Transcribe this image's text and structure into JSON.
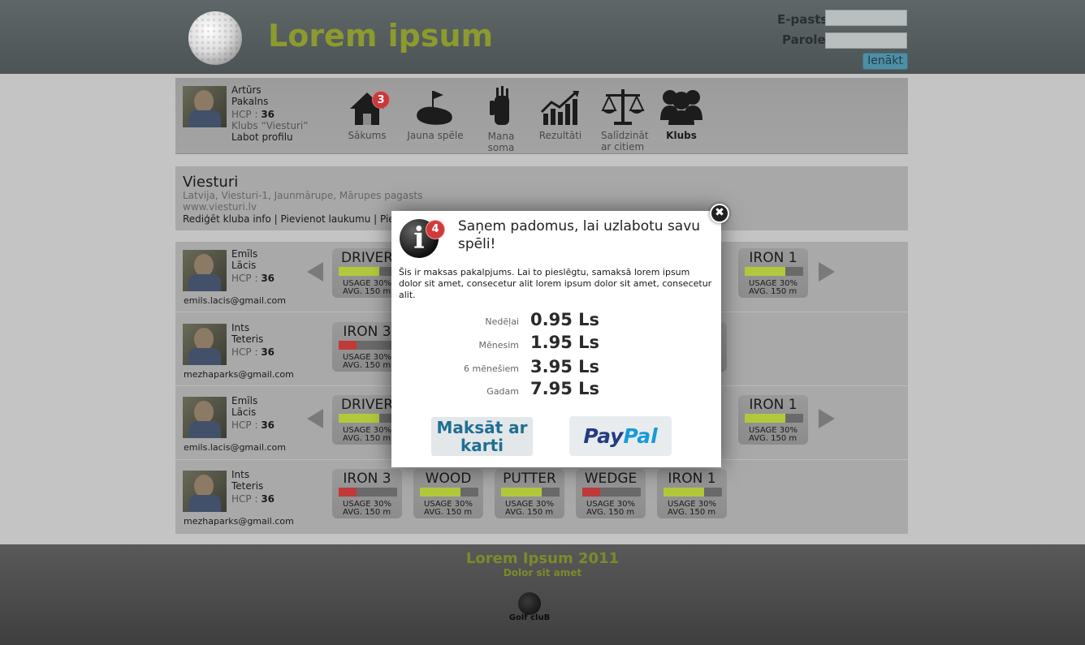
{
  "header": {
    "site_title": "Lorem ipsum",
    "email_label": "E-pasts",
    "password_label": "Parole",
    "login_button": "Ienākt"
  },
  "profile": {
    "first_name": "Artūrs",
    "last_name": "Pakalns",
    "hcp_label": "HCP :",
    "hcp_value": "36",
    "club": "Klubs “Viesturi”",
    "edit_link": "Labot profilu"
  },
  "nav": [
    {
      "label": "Sākums",
      "badge": "3",
      "icon": "home-icon"
    },
    {
      "label": "Jauna spēle",
      "icon": "golf-green-icon"
    },
    {
      "label": "Mana soma",
      "icon": "golf-bag-icon"
    },
    {
      "label": "Rezultāti",
      "icon": "chart-icon"
    },
    {
      "label": "Salīdzināt",
      "label2": "ar citiem",
      "icon": "scales-icon"
    },
    {
      "label": "Klubs",
      "icon": "group-icon"
    }
  ],
  "club": {
    "name": "Viesturi",
    "address": "Latvija, Viesturi-1, Jaunmārupe, Mārupes pagasts",
    "website": "www.viesturi.lv",
    "link_edit": "Rediģēt kluba info",
    "separator": "|",
    "link_add_course": "Pievienot laukumu",
    "link_more": "Piet"
  },
  "players": [
    {
      "first": "Emīls",
      "last": "Lācis",
      "hcp_label": "HCP :",
      "hcp": "36",
      "email": "emils.lacis@gmail.com",
      "cards": [
        {
          "title": "DRIVER",
          "usage": "USAGE 30%",
          "avg": "AVG. 150 m"
        },
        {
          "title": "IRON 1",
          "usage": "USAGE 30%",
          "avg": "AVG. 150 m"
        }
      ]
    },
    {
      "first": "Ints",
      "last": "Teteris",
      "hcp_label": "HCP :",
      "hcp": "36",
      "email": "mezhaparks@gmail.com",
      "cards": [
        {
          "title": "IRON 3",
          "usage": "USAGE 30%",
          "avg": "AVG. 150 m"
        }
      ]
    },
    {
      "first": "Emīls",
      "last": "Lācis",
      "hcp_label": "HCP :",
      "hcp": "36",
      "email": "emils.lacis@gmail.com",
      "cards": [
        {
          "title": "DRIVER",
          "usage": "USAGE 30%",
          "avg": "AVG. 150 m"
        },
        {
          "title": "IRON 1",
          "usage": "USAGE 30%",
          "avg": "AVG. 150 m"
        }
      ]
    },
    {
      "first": "Ints",
      "last": "Teteris",
      "hcp_label": "HCP :",
      "hcp": "36",
      "email": "mezhaparks@gmail.com",
      "cards": [
        {
          "title": "IRON 3",
          "usage": "USAGE 30%",
          "avg": "AVG. 150 m"
        },
        {
          "title": "WOOD",
          "usage": "USAGE 30%",
          "avg": "AVG. 150 m"
        },
        {
          "title": "PUTTER",
          "usage": "USAGE 30%",
          "avg": "AVG. 150 m"
        },
        {
          "title": "WEDGE",
          "usage": "USAGE 30%",
          "avg": "AVG. 150 m"
        },
        {
          "title": "IRON 1",
          "usage": "USAGE 30%",
          "avg": "AVG. 150 m"
        }
      ]
    }
  ],
  "modal": {
    "badge": "4",
    "info_glyph": "i",
    "close_glyph": "✖",
    "title": "Saņem padomus, lai uzlabotu savu spēli!",
    "description": "Šis ir maksas pakalpjums. Lai to pieslēgtu, samaksā lorem ipsum dolor sit amet, consecetur alit lorem ipsum dolor sit amet, consecetur alit.",
    "prices": [
      {
        "label": "Nedēļai",
        "value": "0.95 Ls"
      },
      {
        "label": "Mēnesim",
        "value": "1.95 Ls"
      },
      {
        "label": "6 mēnešiem",
        "value": "3.95 Ls"
      },
      {
        "label": "Gadam",
        "value": "7.95 Ls"
      }
    ],
    "pay_card": "Maksāt ar karti",
    "paypal_part1": "Pay",
    "paypal_part2": "Pal"
  },
  "footer": {
    "title": "Lorem Ipsum 2011",
    "subtitle": "Dolor sit amet",
    "logo_text": "Golf cluB"
  },
  "colors": {
    "accent_olive": "#8c9a2e",
    "bar_green": "#b4c83c",
    "bar_red": "#c03a3a",
    "paypal_dark": "#253b80",
    "paypal_light": "#179bd7"
  }
}
